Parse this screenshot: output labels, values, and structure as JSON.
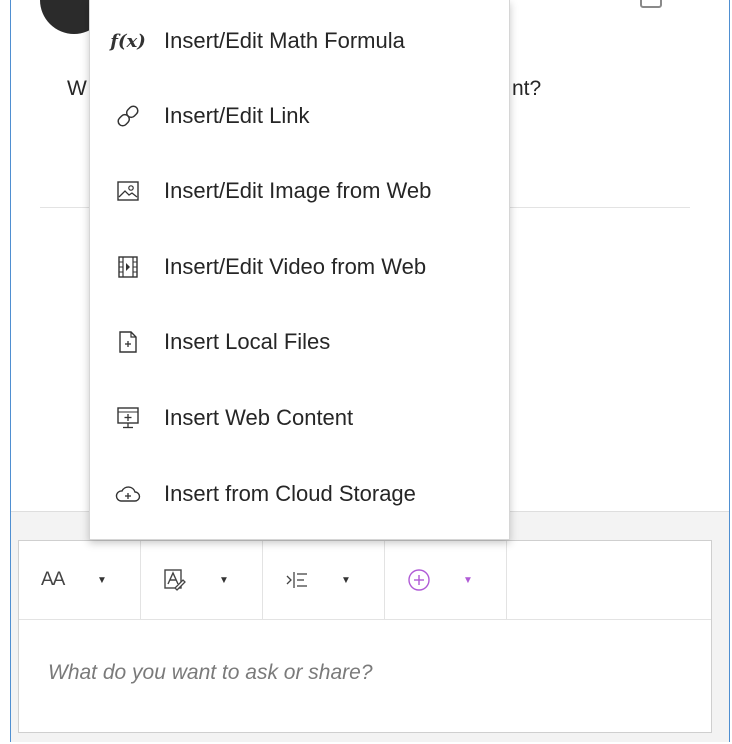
{
  "post": {
    "question_start": "W",
    "question_end": "nt?"
  },
  "menu": {
    "items": [
      {
        "label": "Insert/Edit Math Formula",
        "icon": "math-formula-icon"
      },
      {
        "label": "Insert/Edit Link",
        "icon": "link-icon"
      },
      {
        "label": "Insert/Edit Image from Web",
        "icon": "image-icon"
      },
      {
        "label": "Insert/Edit Video from Web",
        "icon": "video-icon"
      },
      {
        "label": "Insert Local Files",
        "icon": "local-file-icon"
      },
      {
        "label": "Insert Web Content",
        "icon": "web-content-icon"
      },
      {
        "label": "Insert from Cloud Storage",
        "icon": "cloud-storage-icon"
      }
    ]
  },
  "toolbar": {
    "text_style_icon": "AA",
    "caret": "▼"
  },
  "editor": {
    "placeholder": "What do you want to ask or share?"
  },
  "colors": {
    "accent_purple": "#b05bd6",
    "frame_blue": "#4f8fd1"
  }
}
